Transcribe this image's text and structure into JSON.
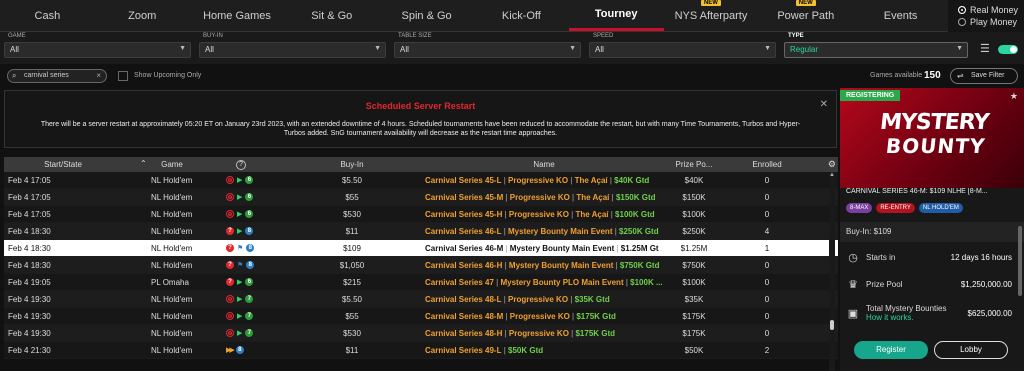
{
  "nav": {
    "tabs": [
      {
        "label": "Cash",
        "new": false
      },
      {
        "label": "Zoom",
        "new": false
      },
      {
        "label": "Home Games",
        "new": false
      },
      {
        "label": "Sit & Go",
        "new": false
      },
      {
        "label": "Spin & Go",
        "new": false
      },
      {
        "label": "Kick-Off",
        "new": false
      },
      {
        "label": "Tourney",
        "new": false,
        "active": true
      },
      {
        "label": "NYS Afterparty",
        "new": true
      },
      {
        "label": "Power Path",
        "new": true
      },
      {
        "label": "Events",
        "new": false
      }
    ],
    "new_badge": "NEW",
    "money": {
      "real": "Real Money",
      "play": "Play Money"
    }
  },
  "filters": {
    "game": {
      "label": "GAME",
      "value": "All"
    },
    "buyin": {
      "label": "BUY-IN",
      "value": "All"
    },
    "table_size": {
      "label": "TABLE SIZE",
      "value": "All"
    },
    "speed": {
      "label": "SPEED",
      "value": "All"
    },
    "type": {
      "label": "TYPE",
      "value": "Regular"
    }
  },
  "search": {
    "value": "carnival series"
  },
  "show_upcoming_label": "Show Upcoming Only",
  "games_available_label": "Games available",
  "games_available": "150",
  "save_filter_label": "Save Filter",
  "notice": {
    "title": "Scheduled Server Restart",
    "text": "There will be a server restart at approximately 05:20 ET on January 23rd 2023, with an extended downtime of 4 hours. Scheduled tournaments have been reduced to accommodate the restart, but with many Time Tournaments, Turbos and Hyper-Turbos added. SnG tournament availability will decrease as the restart time approaches."
  },
  "table": {
    "headers": {
      "start": "Start/State",
      "game": "Game",
      "buyin": "Buy-In",
      "name": "Name",
      "prize": "Prize Po...",
      "enrolled": "Enrolled"
    },
    "rows": [
      {
        "date": "Feb 4",
        "time": "17:05",
        "game": "NL Hold'em",
        "icons": [
          "ko",
          "play",
          "six"
        ],
        "buyin": "$5.50",
        "n1": "Carnival Series 45-L",
        "n2": "Progressive KO",
        "n3": "The Açaí",
        "gtd": "$40K Gtd",
        "prize": "$40K",
        "enrolled": "0"
      },
      {
        "date": "Feb 4",
        "time": "17:05",
        "game": "NL Hold'em",
        "icons": [
          "ko",
          "play",
          "six"
        ],
        "buyin": "$55",
        "n1": "Carnival Series 45-M",
        "n2": "Progressive KO",
        "n3": "The Açaí",
        "gtd": "$150K Gtd",
        "prize": "$150K",
        "enrolled": "0"
      },
      {
        "date": "Feb 4",
        "time": "17:05",
        "game": "NL Hold'em",
        "icons": [
          "ko",
          "play",
          "six"
        ],
        "buyin": "$530",
        "n1": "Carnival Series 45-H",
        "n2": "Progressive KO",
        "n3": "The Açaí",
        "gtd": "$100K Gtd",
        "prize": "$100K",
        "enrolled": "0"
      },
      {
        "date": "Feb 4",
        "time": "18:30",
        "game": "NL Hold'em",
        "icons": [
          "mb",
          "play",
          "eight"
        ],
        "buyin": "$11",
        "n1": "Carnival Series 46-L",
        "n2": "Mystery Bounty Main Event",
        "n3": "",
        "gtd": "$250K Gtd",
        "prize": "$250K",
        "enrolled": "4"
      },
      {
        "date": "Feb 4",
        "time": "18:30",
        "game": "NL Hold'em",
        "icons": [
          "mb",
          "flag",
          "eight"
        ],
        "buyin": "$109",
        "n1": "Carnival Series 46-M",
        "n2": "Mystery Bounty Main Event",
        "n3": "",
        "gtd": "$1.25M Gt",
        "prize": "$1.25M",
        "enrolled": "1",
        "selected": true
      },
      {
        "date": "Feb 4",
        "time": "18:30",
        "game": "NL Hold'em",
        "icons": [
          "mb",
          "flag",
          "eight"
        ],
        "buyin": "$1,050",
        "n1": "Carnival Series 46-H",
        "n2": "Mystery Bounty Main Event",
        "n3": "",
        "gtd": "$750K Gtd",
        "prize": "$750K",
        "enrolled": "0"
      },
      {
        "date": "Feb 4",
        "time": "19:05",
        "game": "PL Omaha",
        "icons": [
          "mb",
          "play",
          "six"
        ],
        "buyin": "$215",
        "n1": "Carnival Series 47",
        "n2": "Mystery Bounty PLO Main Event",
        "n3": "",
        "gtd": "$100K ...",
        "prize": "$100K",
        "enrolled": "0"
      },
      {
        "date": "Feb 4",
        "time": "19:30",
        "game": "NL Hold'em",
        "icons": [
          "ko",
          "play",
          "seven"
        ],
        "buyin": "$5.50",
        "n1": "Carnival Series 48-L",
        "n2": "Progressive KO",
        "n3": "",
        "gtd": "$35K Gtd",
        "prize": "$35K",
        "enrolled": "0"
      },
      {
        "date": "Feb 4",
        "time": "19:30",
        "game": "NL Hold'em",
        "icons": [
          "ko",
          "play",
          "seven"
        ],
        "buyin": "$55",
        "n1": "Carnival Series 48-M",
        "n2": "Progressive KO",
        "n3": "",
        "gtd": "$175K Gtd",
        "prize": "$175K",
        "enrolled": "0"
      },
      {
        "date": "Feb 4",
        "time": "19:30",
        "game": "NL Hold'em",
        "icons": [
          "ko",
          "play",
          "seven"
        ],
        "buyin": "$530",
        "n1": "Carnival Series 48-H",
        "n2": "Progressive KO",
        "n3": "",
        "gtd": "$175K Gtd",
        "prize": "$175K",
        "enrolled": "0"
      },
      {
        "date": "Feb 4",
        "time": "21:30",
        "game": "NL Hold'em",
        "icons": [
          "ff",
          "eight"
        ],
        "buyin": "$11",
        "n1": "Carnival Series 49-L",
        "n2": "",
        "n3": "",
        "gtd": "$50K Gtd",
        "prize": "$50K",
        "enrolled": "2"
      }
    ]
  },
  "panel": {
    "status": "REGISTERING",
    "promo_line1": "MYSTERY",
    "promo_line2": "BOUNTY",
    "title": "CARNIVAL SERIES 46-M: $109 NLHE [8-M...",
    "chips": [
      "8-MAX",
      "RE-ENTRY",
      "NL HOLD'EM"
    ],
    "buyin_label": "Buy-In: $109",
    "starts_label": "Starts in",
    "starts_value": "12 days 16 hours",
    "prize_label": "Prize Pool",
    "prize_value": "$1,250,000.00",
    "bounty_label": "Total Mystery Bounties",
    "bounty_link": "How it works.",
    "bounty_value": "$625,000.00",
    "register": "Register",
    "lobby": "Lobby"
  }
}
